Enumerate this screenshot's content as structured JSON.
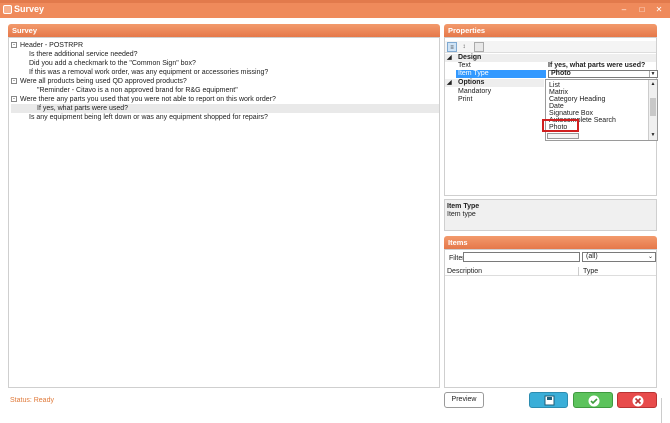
{
  "window": {
    "title": "Survey",
    "minimize_icon": "minimize-icon",
    "maximize_icon": "maximize-icon",
    "close_icon": "close-icon"
  },
  "survey": {
    "panel_title": "Survey",
    "tree": [
      {
        "text": "Header - POSTRPR",
        "level": 0,
        "toggle": "-"
      },
      {
        "text": "Is there additional service needed?",
        "level": 1
      },
      {
        "text": "Did you add a checkmark to the \"Common Sign\" box?",
        "level": 1
      },
      {
        "text": "If this was a removal work order, was any equipment or accessories missing?",
        "level": 1
      },
      {
        "text": "Were all products being used QD approved products?",
        "level": 0,
        "toggle": "-"
      },
      {
        "text": "\"Reminder - Citavo is a non approved brand for R&G equipment\"",
        "level": 2
      },
      {
        "text": "Were there any parts you used that you were not able to report on this work order?",
        "level": 0,
        "toggle": "-"
      },
      {
        "text": "If yes, what parts were used?",
        "level": 2,
        "selected": true
      },
      {
        "text": "Is any equipment being left down or was any equipment shopped for repairs?",
        "level": 1
      }
    ]
  },
  "properties": {
    "panel_title": "Properties",
    "toolbar_icons": [
      "categorized-icon",
      "alphabetical-icon",
      "property-pages-icon"
    ],
    "design_category": "Design",
    "text_label": "Text",
    "text_value": "If yes, what parts were used?",
    "item_type_label": "Item Type",
    "item_type_value": "Photo",
    "options_category": "Options",
    "mandatory_label": "Mandatory",
    "print_label": "Print",
    "dropdown_options": [
      "List",
      "Matrix",
      "Category Heading",
      "Date",
      "Signature Box",
      "Autocomplete Search",
      "Photo"
    ],
    "dropdown_highlighted": "Photo",
    "description_title": "Item Type",
    "description_text": "Item type"
  },
  "items": {
    "panel_title": "Items",
    "filter_label": "Filter",
    "filter_value": "",
    "filter_select": "(all)",
    "col_description": "Description",
    "col_type": "Type"
  },
  "status": {
    "text": "Status: Ready"
  },
  "buttons": {
    "preview": "Preview",
    "save_icon": "save-icon",
    "ok_icon": "check-icon",
    "cancel_icon": "cancel-icon"
  },
  "colors": {
    "accent": "#ef8a5b",
    "status": "#e07a3a",
    "highlight_box": "#d01f1f",
    "save": "#3aaed8",
    "ok": "#5cc35c",
    "cancel": "#e84b4b"
  }
}
